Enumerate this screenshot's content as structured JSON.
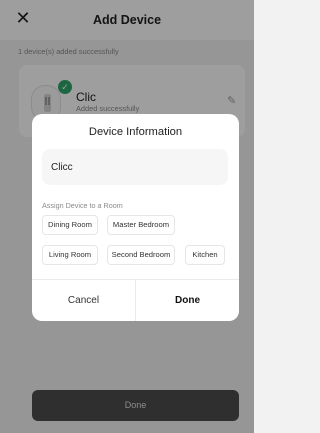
{
  "header": {
    "title": "Add Device",
    "close_icon": "close-icon"
  },
  "summary": {
    "success_text": "1 device(s) added successfully"
  },
  "device": {
    "name": "Clic",
    "status": "Added successfully",
    "edit_icon": "edit-icon",
    "check_icon": "check-icon"
  },
  "dialog": {
    "title": "Device Information",
    "name_input_value": "Clicc",
    "assign_label": "Assign Device to a Room",
    "rooms": [
      "Dining Room",
      "Master Bedroom",
      "Living Room",
      "Second Bedroom",
      "Kitchen"
    ],
    "cancel_label": "Cancel",
    "done_label": "Done"
  },
  "footer": {
    "done_label": "Done"
  },
  "colors": {
    "success": "#2ea66b",
    "overlay": "rgba(0,0,0,0.38)",
    "footer_button": "#2f2f2f"
  }
}
